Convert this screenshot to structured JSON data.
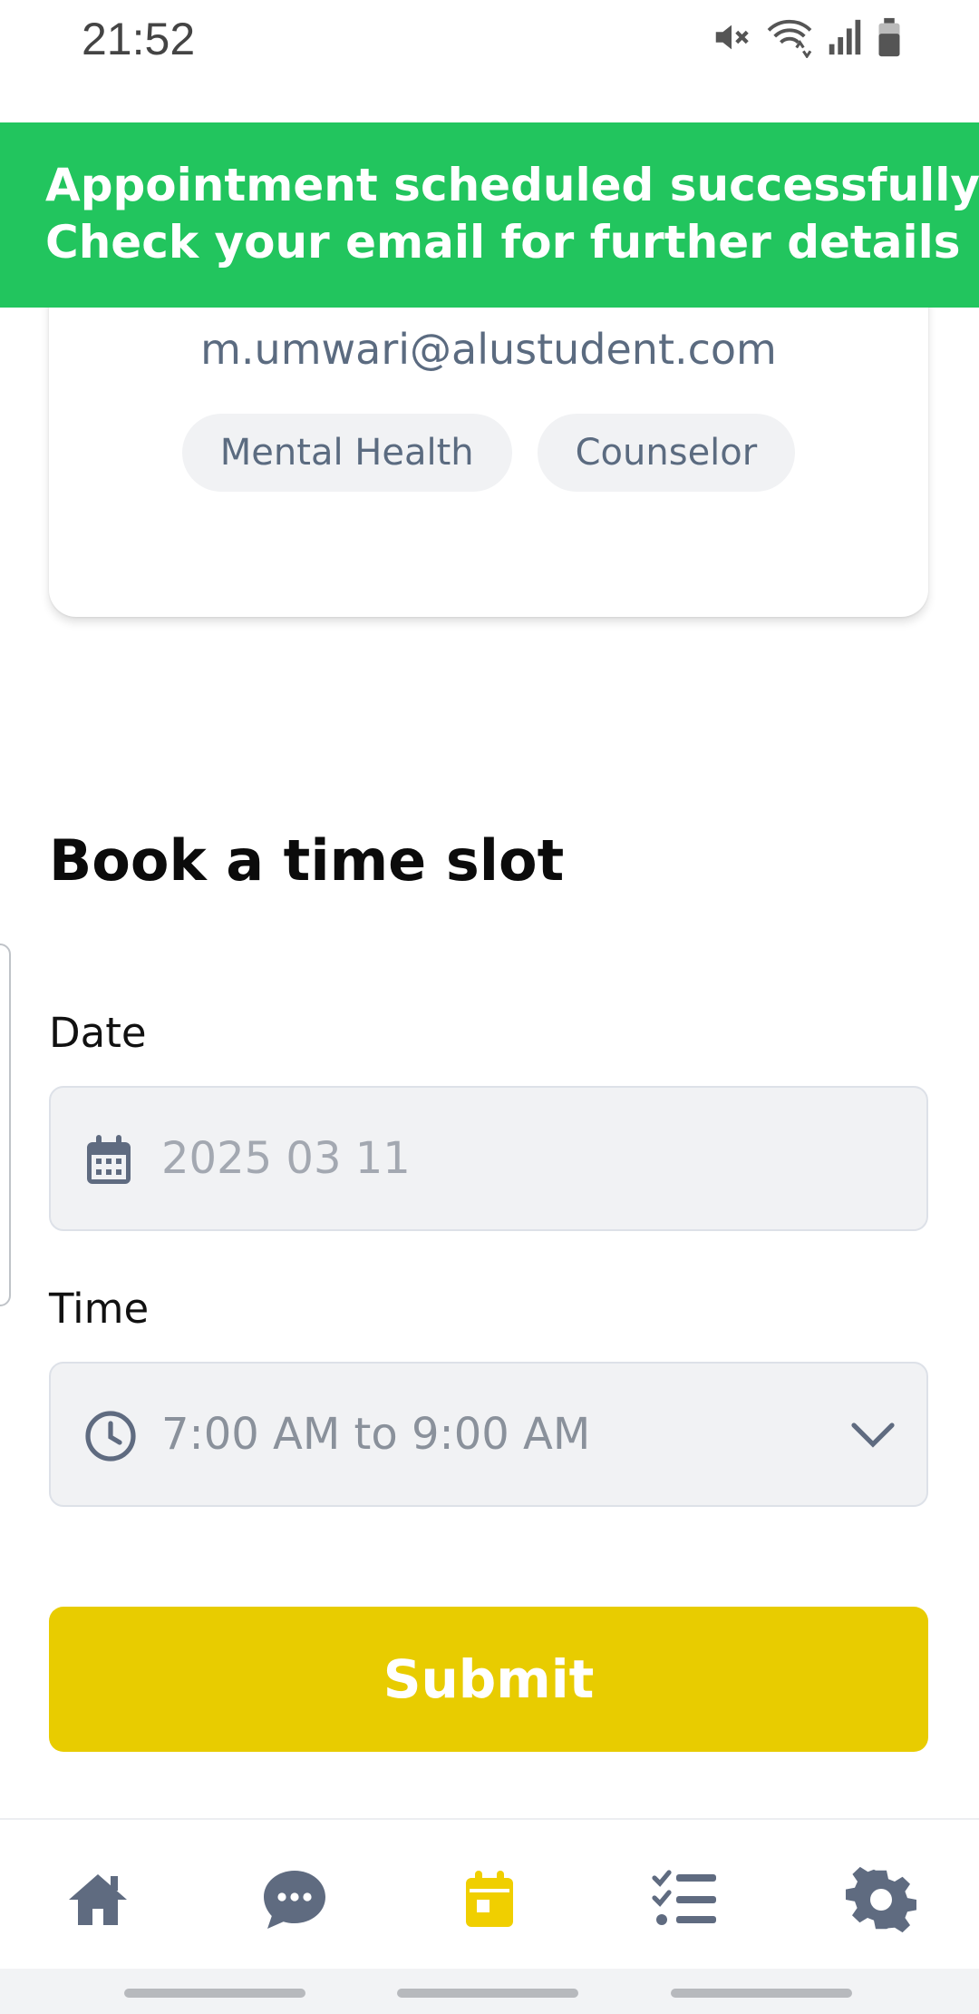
{
  "status_bar": {
    "time": "21:52",
    "icons": [
      "mute-icon",
      "wifi-icon",
      "signal-icon",
      "battery-icon"
    ]
  },
  "toast": {
    "line1": "Appointment scheduled successfully.",
    "line2": "Check your email for further details",
    "color": "#22c55e"
  },
  "counselor_card": {
    "email": "m.umwari@alustudent.com",
    "tags": [
      "Mental Health",
      "Counselor"
    ]
  },
  "booking": {
    "title": "Book a time slot",
    "date_label": "Date",
    "date_value": "2025 03 11",
    "time_label": "Time",
    "time_value": "7:00 AM to 9:00 AM",
    "submit_label": "Submit",
    "accent_color": "#e8cc00"
  },
  "bottom_nav": {
    "items": [
      {
        "icon": "home-icon",
        "active": false
      },
      {
        "icon": "chat-icon",
        "active": false
      },
      {
        "icon": "calendar-icon",
        "active": true
      },
      {
        "icon": "checklist-icon",
        "active": false
      },
      {
        "icon": "gear-icon",
        "active": false
      }
    ],
    "active_color": "#f0cf00",
    "inactive_color": "#5f6b80"
  }
}
